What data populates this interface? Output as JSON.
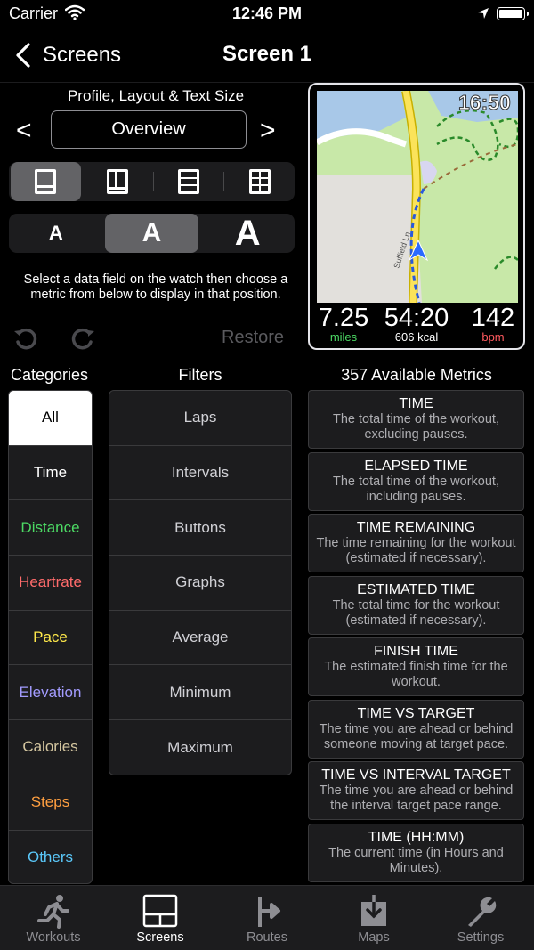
{
  "status": {
    "carrier": "Carrier",
    "time": "12:46 PM"
  },
  "nav": {
    "back_label": "Screens",
    "title": "Screen 1"
  },
  "profile": {
    "label": "Profile, Layout & Text Size",
    "prev": "<",
    "next": ">",
    "value": "Overview"
  },
  "text_size": {
    "options": [
      "A",
      "A",
      "A"
    ],
    "selected_index": 1
  },
  "layout": {
    "selected_index": 0
  },
  "hint": "Select a data field on the watch then choose a metric from below to display in that position.",
  "restore_label": "Restore",
  "watch": {
    "time": "16:50",
    "street": "Suffield Ln",
    "metrics": [
      {
        "value": "7.25",
        "unit": "miles",
        "unit_color": "#4cd964"
      },
      {
        "value": "54:20",
        "unit": "606 kcal",
        "unit_color": "#ffffff"
      },
      {
        "value": "142",
        "unit": "bpm",
        "unit_color": "#ff5a5f"
      }
    ]
  },
  "headers": {
    "categories": "Categories",
    "filters": "Filters",
    "metrics": "357 Available Metrics"
  },
  "categories": [
    {
      "label": "All",
      "color": "#000000"
    },
    {
      "label": "Time",
      "color": "#ffffff"
    },
    {
      "label": "Distance",
      "color": "#4cd964"
    },
    {
      "label": "Heartrate",
      "color": "#ff6b6b"
    },
    {
      "label": "Pace",
      "color": "#ffe94a"
    },
    {
      "label": "Elevation",
      "color": "#a29bfe"
    },
    {
      "label": "Calories",
      "color": "#d4c6a0"
    },
    {
      "label": "Steps",
      "color": "#ff9f40"
    },
    {
      "label": "Others",
      "color": "#5ac8fa"
    }
  ],
  "filters": [
    "Laps",
    "Intervals",
    "Buttons",
    "Graphs",
    "Average",
    "Minimum",
    "Maximum"
  ],
  "metrics": [
    {
      "title": "TIME",
      "desc": "The total time of the workout, excluding pauses."
    },
    {
      "title": "ELAPSED TIME",
      "desc": "The total time of the workout, including pauses."
    },
    {
      "title": "TIME REMAINING",
      "desc": "The time remaining for the workout (estimated if necessary)."
    },
    {
      "title": "ESTIMATED TIME",
      "desc": "The total time for the workout (estimated if necessary)."
    },
    {
      "title": "FINISH TIME",
      "desc": "The estimated finish time for the workout."
    },
    {
      "title": "TIME VS TARGET",
      "desc": "The time you are ahead or behind someone moving at target pace."
    },
    {
      "title": "TIME VS INTERVAL TARGET",
      "desc": "The time you are ahead or behind the interval target pace range."
    },
    {
      "title": "TIME (HH:MM)",
      "desc": "The current time (in Hours and Minutes)."
    }
  ],
  "tabs": [
    {
      "label": "Workouts",
      "icon": "runner-icon"
    },
    {
      "label": "Screens",
      "icon": "screens-icon"
    },
    {
      "label": "Routes",
      "icon": "routes-icon"
    },
    {
      "label": "Maps",
      "icon": "maps-icon"
    },
    {
      "label": "Settings",
      "icon": "wrench-icon"
    }
  ],
  "active_tab": 1
}
